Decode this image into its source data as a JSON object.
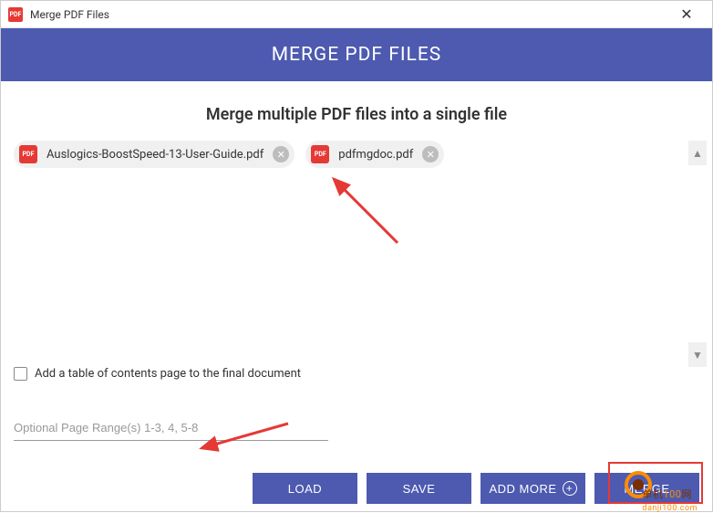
{
  "titlebar": {
    "icon_label": "PDF",
    "title": "Merge PDF Files"
  },
  "banner": "MERGE PDF FILES",
  "subtitle": "Merge multiple PDF files into a single file",
  "files": [
    {
      "name": "Auslogics-BoostSpeed-13-User-Guide.pdf",
      "icon_label": "PDF"
    },
    {
      "name": "pdfmgdoc.pdf",
      "icon_label": "PDF"
    }
  ],
  "options": {
    "toc_label": "Add a table of contents page to the final document",
    "toc_checked": false
  },
  "range_input": {
    "value": "",
    "placeholder": "Optional Page Range(s) 1-3, 4, 5-8"
  },
  "buttons": {
    "load": "LOAD",
    "save": "SAVE",
    "add_more": "ADD MORE",
    "merge": "MERGE"
  },
  "watermark": {
    "cn": "单机",
    "num": "100",
    "suffix": "网",
    "domain": "danji100.com"
  }
}
